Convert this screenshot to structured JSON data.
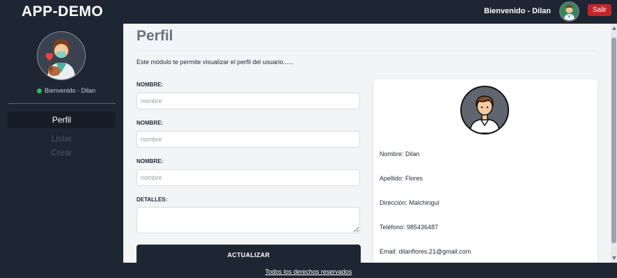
{
  "header": {
    "brand": "APP-DEMO",
    "welcome": "Bienvenido - Dilan",
    "logout_label": "Salir"
  },
  "sidebar": {
    "status": "Bienvenido - Dilan",
    "items": [
      {
        "label": "Perfil",
        "active": true
      },
      {
        "label": "Listar",
        "active": false
      },
      {
        "label": "Crear",
        "active": false
      }
    ]
  },
  "main": {
    "title": "Perfil",
    "description": "Este módulo te permite visualizar el perfil del usuario......",
    "form": {
      "fields": [
        {
          "label": "NOMBRE:",
          "placeholder": "nombre",
          "value": ""
        },
        {
          "label": "NOMBRE:",
          "placeholder": "nombre",
          "value": ""
        },
        {
          "label": "NOMBRE:",
          "placeholder": "nombre",
          "value": ""
        }
      ],
      "details_label": "DETALLES:",
      "details_value": "",
      "submit_label": "ACTUALIZAR"
    },
    "profile": {
      "nombre": "Nombre: Dilan",
      "apellido": "Apellido: Flores",
      "direccion": "Dirección: Malchinguí",
      "telefono": "Teléfono: 985436487",
      "email": "Email: dilanflores.21@gmail.com"
    }
  },
  "footer": {
    "text": "Todos los derechos reservados"
  },
  "colors": {
    "sidebar_bg": "#1f2633",
    "content_bg": "#f3f4f6",
    "logout_bg": "#c0262d",
    "status_dot": "#22c55e"
  }
}
